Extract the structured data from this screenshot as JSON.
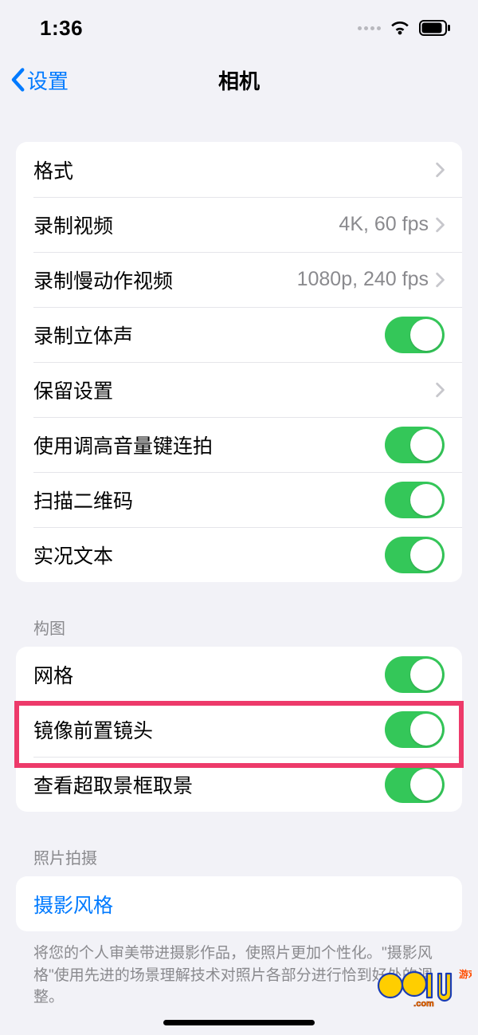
{
  "statusbar": {
    "time": "1:36"
  },
  "nav": {
    "back": "设置",
    "title": "相机"
  },
  "group1": {
    "formats": {
      "label": "格式"
    },
    "record_video": {
      "label": "录制视频",
      "detail": "4K, 60 fps"
    },
    "record_slowmo": {
      "label": "录制慢动作视频",
      "detail": "1080p, 240 fps"
    },
    "stereo": {
      "label": "录制立体声"
    },
    "preserve": {
      "label": "保留设置"
    },
    "burst": {
      "label": "使用调高音量键连拍"
    },
    "qr": {
      "label": "扫描二维码"
    },
    "live_text": {
      "label": "实况文本"
    }
  },
  "group2": {
    "header": "构图",
    "grid": {
      "label": "网格"
    },
    "mirror_front": {
      "label": "镜像前置镜头"
    },
    "view_outside": {
      "label": "查看超取景框取景"
    }
  },
  "group3": {
    "header": "照片拍摄",
    "photographic_styles": {
      "label": "摄影风格"
    },
    "footer": "将您的个人审美带进摄影作品，使照片更加个性化。\"摄影风格\"使用先进的场景理解技术对照片各部分进行恰到好处的调整。"
  }
}
